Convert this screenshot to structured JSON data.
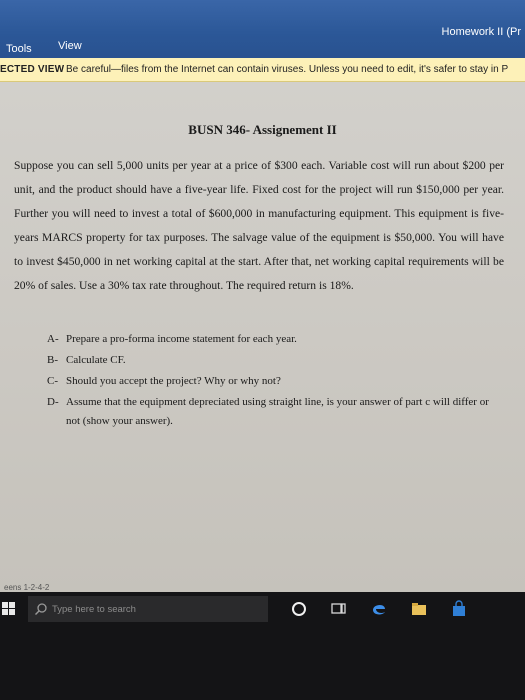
{
  "ribbon": {
    "title": "Homework II (Pr",
    "menu": [
      "Tools",
      "View"
    ]
  },
  "protected_view": {
    "label": "ECTED VIEW",
    "message": "Be careful—files from the Internet can contain viruses. Unless you need to edit, it's safer to stay in P"
  },
  "document": {
    "title": "BUSN 346- Assignement II",
    "paragraph": "Suppose you can sell 5,000 units per year at a price of $300 each. Variable cost will run about $200 per unit, and the product should have a five-year life. Fixed cost for the project will run $150,000 per year. Further you will need to invest a total of $600,000 in manufacturing equipment. This equipment is five-years MARCS property for tax purposes. The salvage value of the equipment is $50,000. You will have to invest $450,000 in net working capital at the start. After that, net working capital requirements will be 20% of sales. Use a 30% tax rate throughout. The required return is 18%.",
    "questions": [
      {
        "letter": "A-",
        "text": "Prepare a pro-forma income statement for each year."
      },
      {
        "letter": "B-",
        "text": "Calculate CF."
      },
      {
        "letter": "C-",
        "text": "Should you accept the project? Why or why not?"
      },
      {
        "letter": "D-",
        "text": "Assume that the equipment depreciated using straight line, is your answer of part c will differ or not (show your answer)."
      }
    ]
  },
  "status_bar": {
    "hint": "eens 1-2-4-2"
  },
  "taskbar": {
    "search_placeholder": "Type here to search",
    "icons": [
      "windows-start-icon",
      "search-icon",
      "cortana-icon",
      "task-view-icon",
      "edge-icon",
      "file-explorer-icon",
      "store-icon"
    ]
  },
  "colors": {
    "ribbon": "#2b5797",
    "protected_bar": "#fdf1b8",
    "page": "#cdcac4",
    "taskbar": "#141416"
  }
}
